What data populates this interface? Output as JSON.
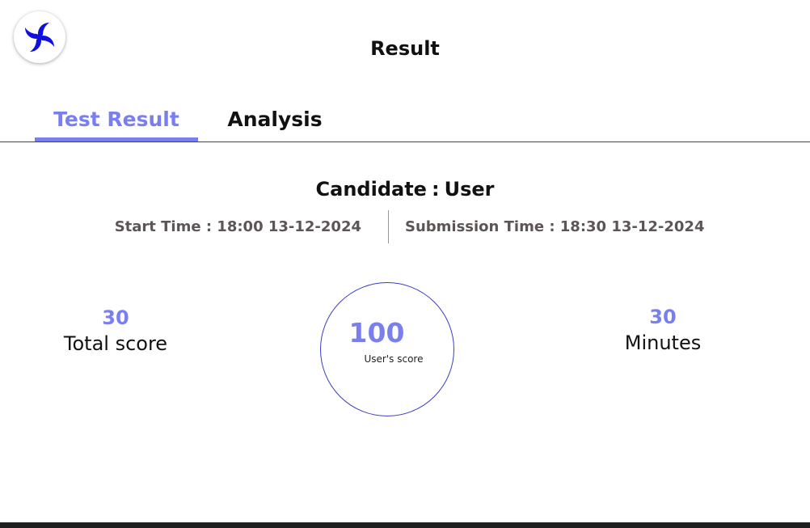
{
  "header": {
    "title": "Result",
    "logo_icon": "pinwheel-icon",
    "logo_color": "#1010e0"
  },
  "tabs": [
    {
      "label": "Test Result",
      "active": true
    },
    {
      "label": "Analysis",
      "active": false
    }
  ],
  "candidate": {
    "label": "Candidate",
    "separator": ":",
    "name": "User"
  },
  "times": {
    "start": "Start Time : 18:00  13-12-2024",
    "submission": "Submission Time : 18:30 13-12-2024"
  },
  "stats": {
    "total_score": {
      "value": "30",
      "label": "Total score"
    },
    "user_score": {
      "value": "100",
      "label": "User's score"
    },
    "minutes": {
      "value": "30",
      "label": "Minutes"
    }
  },
  "colors": {
    "accent": "#7a7ff0",
    "circle_border": "#3a3fbf",
    "time_text": "#5d5555"
  }
}
